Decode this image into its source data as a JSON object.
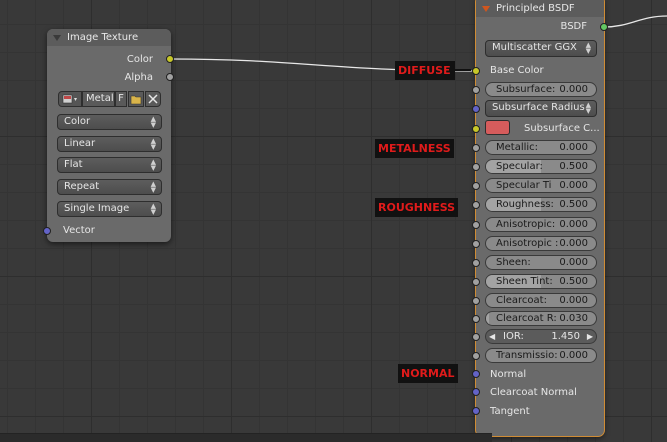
{
  "image_texture": {
    "title": "Image Texture",
    "outputs": [
      "Color",
      "Alpha"
    ],
    "image_name": "Metal",
    "image_f": "F",
    "dropdowns": [
      "Color",
      "Linear",
      "Flat",
      "Repeat",
      "Single Image"
    ],
    "input_vector": "Vector"
  },
  "principled": {
    "title": "Principled BSDF",
    "output": "BSDF",
    "distribution": "Multiscatter GGX",
    "base_color": "Base Color",
    "subsurface": {
      "name": "Subsurface:",
      "value": "0.000"
    },
    "subsurface_method": "Subsurface Radius",
    "subsurface_color": "Subsurface C...",
    "subsurface_color_hex": "#d65c5c",
    "metallic": {
      "name": "Metallic:",
      "value": "0.000"
    },
    "specular": {
      "name": "Specular:",
      "value": "0.500",
      "fill": 0.5
    },
    "specular_tint": {
      "name": "Specular Ti",
      "value": "0.000"
    },
    "roughness": {
      "name": "Roughness:",
      "value": "0.500",
      "fill": 0.5
    },
    "anisotropic": {
      "name": "Anisotropic:",
      "value": "0.000"
    },
    "anisotropic_rot": {
      "name": "Anisotropic :",
      "value": "0.000"
    },
    "sheen": {
      "name": "Sheen:",
      "value": "0.000"
    },
    "sheen_tint": {
      "name": "Sheen Tint:",
      "value": "0.500",
      "fill": 0.5
    },
    "clearcoat": {
      "name": "Clearcoat:",
      "value": "0.000"
    },
    "clearcoat_r": {
      "name": "Clearcoat R:",
      "value": "0.030",
      "fill": 0.03
    },
    "ior": {
      "name": "IOR:",
      "value": "1.450"
    },
    "transmission": {
      "name": "Transmissio:",
      "value": "0.000"
    },
    "normal": "Normal",
    "clearcoat_normal": "Clearcoat Normal",
    "tangent": "Tangent"
  },
  "annotations": {
    "diffuse": "DIFFUSE",
    "metalness": "METALNESS",
    "roughness": "ROUGHNESS",
    "normal": "NORMAL"
  },
  "colors": {
    "annotation_text": "#e01b1b",
    "annotation_bg": "#111111",
    "selected_outline": "#d08c34"
  }
}
